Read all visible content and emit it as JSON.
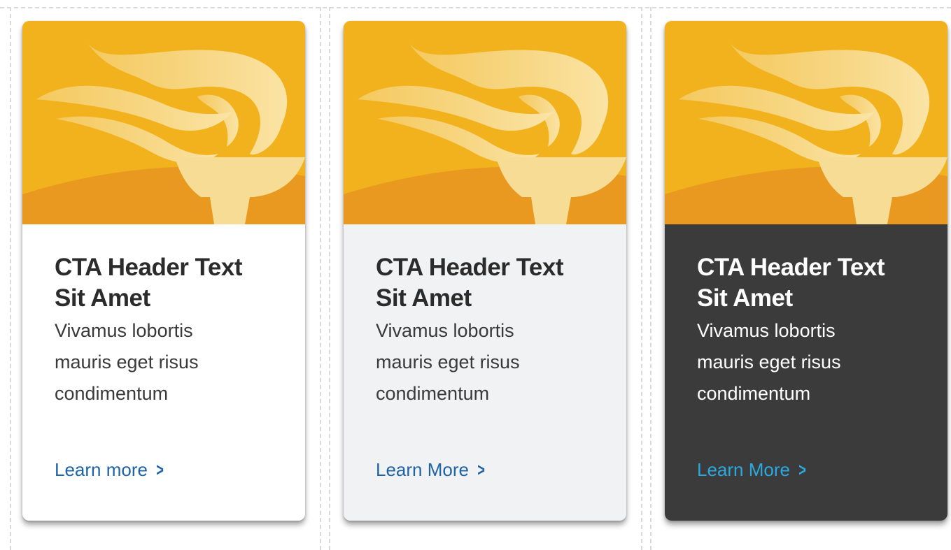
{
  "colors": {
    "banner_yellow": "#f1b21d",
    "banner_orange": "#e9991f",
    "flame_cream": "#f7dc95",
    "white_card": "#ffffff",
    "light_card": "#f1f2f3",
    "dark_card": "#3b3b3b",
    "link_blue": "#1f64a8",
    "link_cyan": "#2aa9e0"
  },
  "cards": [
    {
      "variant": "white",
      "image_icon": "torch-icon",
      "title_line1": "CTA Header Text",
      "title_line2": "Sit Amet",
      "desc_line1": "Vivamus lobortis",
      "desc_line2": "mauris eget risus",
      "desc_line3": "condimentum",
      "link_label": "Learn more",
      "link_icon": "chevron-right-icon"
    },
    {
      "variant": "light-gray",
      "image_icon": "torch-icon",
      "title_line1": "CTA Header Text",
      "title_line2": "Sit Amet",
      "desc_line1": "Vivamus lobortis",
      "desc_line2": "mauris eget risus",
      "desc_line3": "condimentum",
      "link_label": "Learn More",
      "link_icon": "chevron-right-icon"
    },
    {
      "variant": "dark",
      "image_icon": "torch-icon",
      "title_line1": "CTA Header Text",
      "title_line2": "Sit Amet",
      "desc_line1": "Vivamus lobortis",
      "desc_line2": "mauris eget risus",
      "desc_line3": "condimentum",
      "link_label": "Learn More",
      "link_icon": "chevron-right-icon"
    }
  ]
}
